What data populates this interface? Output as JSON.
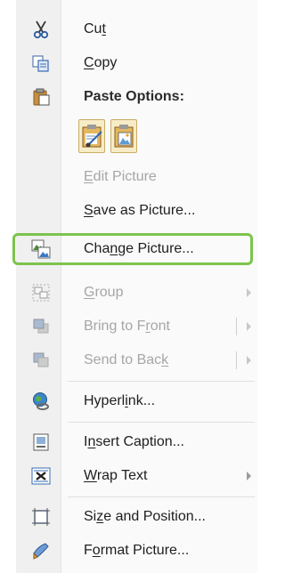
{
  "menu": {
    "cut": {
      "pre": "Cu",
      "u": "t",
      "post": "",
      "icon": "scissors-icon"
    },
    "copy": {
      "pre": "",
      "u": "C",
      "post": "opy",
      "icon": "copy-icon"
    },
    "paste_options": {
      "label": "Paste Options:",
      "icon": "clipboard-icon",
      "options": [
        {
          "icon": "paste-use-destination-theme-icon"
        },
        {
          "icon": "paste-picture-icon"
        }
      ]
    },
    "edit_picture": {
      "pre": "",
      "u": "E",
      "post": "dit Picture"
    },
    "save_as_picture": {
      "pre": "",
      "u": "S",
      "post": "ave as Picture..."
    },
    "change_picture": {
      "pre": "Cha",
      "u": "n",
      "post": "ge Picture...",
      "icon": "change-picture-icon"
    },
    "group": {
      "pre": "",
      "u": "G",
      "post": "roup",
      "icon": "group-icon"
    },
    "bring_to_front": {
      "pre": "Bring to F",
      "u": "r",
      "post": "ont",
      "icon": "bring-to-front-icon"
    },
    "send_to_back": {
      "pre": "Send to Bac",
      "u": "k",
      "post": "",
      "icon": "send-to-back-icon"
    },
    "hyperlink": {
      "pre": "Hyperl",
      "u": "i",
      "post": "nk...",
      "icon": "globe-link-icon"
    },
    "insert_caption": {
      "pre": "I",
      "u": "n",
      "post": "sert Caption...",
      "icon": "caption-icon"
    },
    "wrap_text": {
      "pre": "",
      "u": "W",
      "post": "rap Text",
      "icon": "wrap-text-icon"
    },
    "size_and_position": {
      "pre": "Si",
      "u": "z",
      "post": "e and Position...",
      "icon": "size-position-icon"
    },
    "format_picture": {
      "pre": "F",
      "u": "o",
      "post": "rmat Picture...",
      "icon": "format-picture-icon"
    }
  },
  "highlight_color": "#7cc44c"
}
